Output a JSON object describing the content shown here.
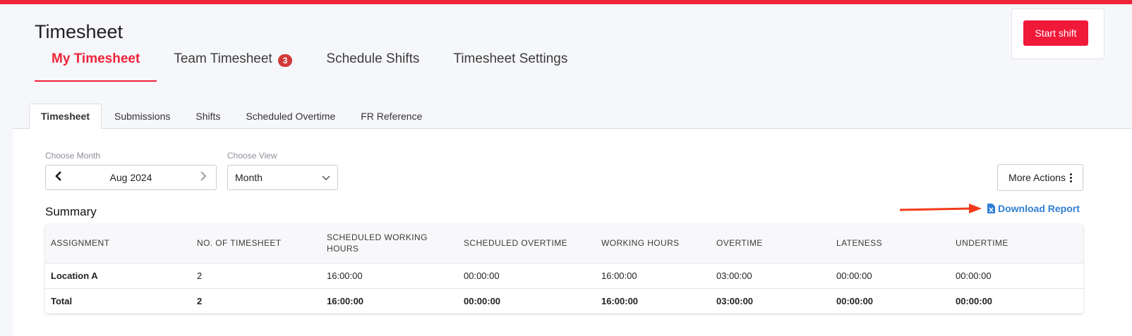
{
  "header": {
    "title": "Timesheet",
    "start_shift_label": "Start shift",
    "accent_color": "#f0233a"
  },
  "main_tabs": [
    {
      "label": "My Timesheet",
      "active": true
    },
    {
      "label": "Team Timesheet",
      "badge": "3"
    },
    {
      "label": "Schedule Shifts"
    },
    {
      "label": "Timesheet Settings"
    }
  ],
  "sub_tabs": [
    {
      "label": "Timesheet",
      "active": true
    },
    {
      "label": "Submissions"
    },
    {
      "label": "Shifts"
    },
    {
      "label": "Scheduled Overtime"
    },
    {
      "label": "FR Reference"
    }
  ],
  "filters": {
    "month_label": "Choose Month",
    "month_value": "Aug 2024",
    "view_label": "Choose View",
    "view_value": "Month"
  },
  "more_actions_label": "More Actions",
  "summary": {
    "title": "Summary",
    "download_label": "Download Report",
    "columns": [
      "ASSIGNMENT",
      "NO. OF TIMESHEET",
      "SCHEDULED WORKING HOURS",
      "SCHEDULED OVERTIME",
      "WORKING HOURS",
      "OVERTIME",
      "LATENESS",
      "UNDERTIME"
    ],
    "rows": [
      [
        "Location A",
        "2",
        "16:00:00",
        "00:00:00",
        "16:00:00",
        "03:00:00",
        "00:00:00",
        "00:00:00"
      ]
    ],
    "total": [
      "Total",
      "2",
      "16:00:00",
      "00:00:00",
      "16:00:00",
      "03:00:00",
      "00:00:00",
      "00:00:00"
    ]
  }
}
